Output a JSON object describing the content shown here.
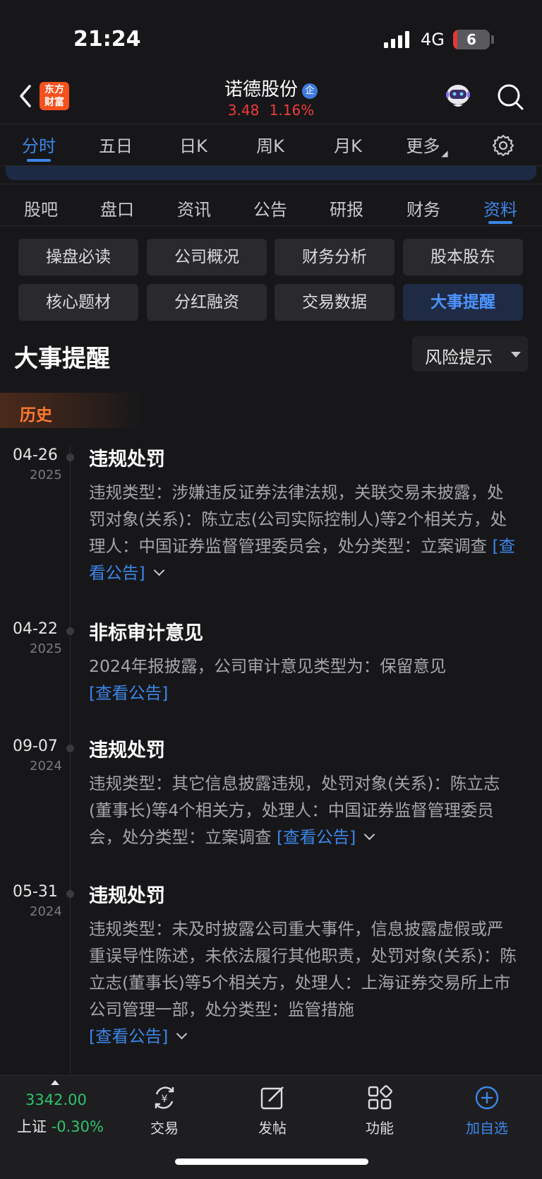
{
  "status": {
    "time": "21:24",
    "network": "4G",
    "battery": "6"
  },
  "header": {
    "stock_name": "诺德股份",
    "badge": "企",
    "price": "3.48",
    "change_pct": "1.16%",
    "logo_line1": "东方",
    "logo_line2": "财富"
  },
  "chart_tabs": [
    "分时",
    "五日",
    "日K",
    "周K",
    "月K",
    "更多"
  ],
  "info_tabs": [
    "股吧",
    "盘口",
    "资讯",
    "公告",
    "研报",
    "财务",
    "资料"
  ],
  "sub_buttons": [
    "操盘必读",
    "公司概况",
    "财务分析",
    "股本股东",
    "核心题材",
    "分红融资",
    "交易数据",
    "大事提醒"
  ],
  "section": {
    "title": "大事提醒",
    "filter": "风险提示",
    "history": "历史"
  },
  "events": [
    {
      "date": "04-26",
      "year": "2025",
      "title": "违规处罚",
      "body": "违规类型：涉嫌违反证券法律法规，关联交易未披露，处罚对象(关系)：陈立志(公司实际控制人)等2个相关方，处理人：中国证券监督管理委员会，处分类型：立案调查",
      "link": "[查看公告]"
    },
    {
      "date": "04-22",
      "year": "2025",
      "title": "非标审计意见",
      "body": "2024年报披露，公司审计意见类型为：保留意见",
      "link": "[查看公告]"
    },
    {
      "date": "09-07",
      "year": "2024",
      "title": "违规处罚",
      "body": "违规类型：其它信息披露违规，处罚对象(关系)：陈立志(董事长)等4个相关方，处理人：中国证券监督管理委员会，处分类型：立案调查",
      "link": "[查看公告]"
    },
    {
      "date": "05-31",
      "year": "2024",
      "title": "违规处罚",
      "body": "违规类型：未及时披露公司重大事件，信息披露虚假或严重误导性陈述，未依法履行其他职责，处罚对象(关系)：陈立志(董事长)等5个相关方，处理人：上海证券交易所上市公司管理一部，处分类型：监管措施",
      "link": "[查看公告]"
    }
  ],
  "bottom": {
    "index_value": "3342.00",
    "index_name": "上证",
    "index_pct": "-0.30%",
    "nav": [
      "交易",
      "发帖",
      "功能",
      "加自选"
    ]
  },
  "colors": {
    "accent": "#3d86e8",
    "up": "#f23b3b",
    "down": "#2ec46b",
    "history": "#ff7a2e"
  }
}
